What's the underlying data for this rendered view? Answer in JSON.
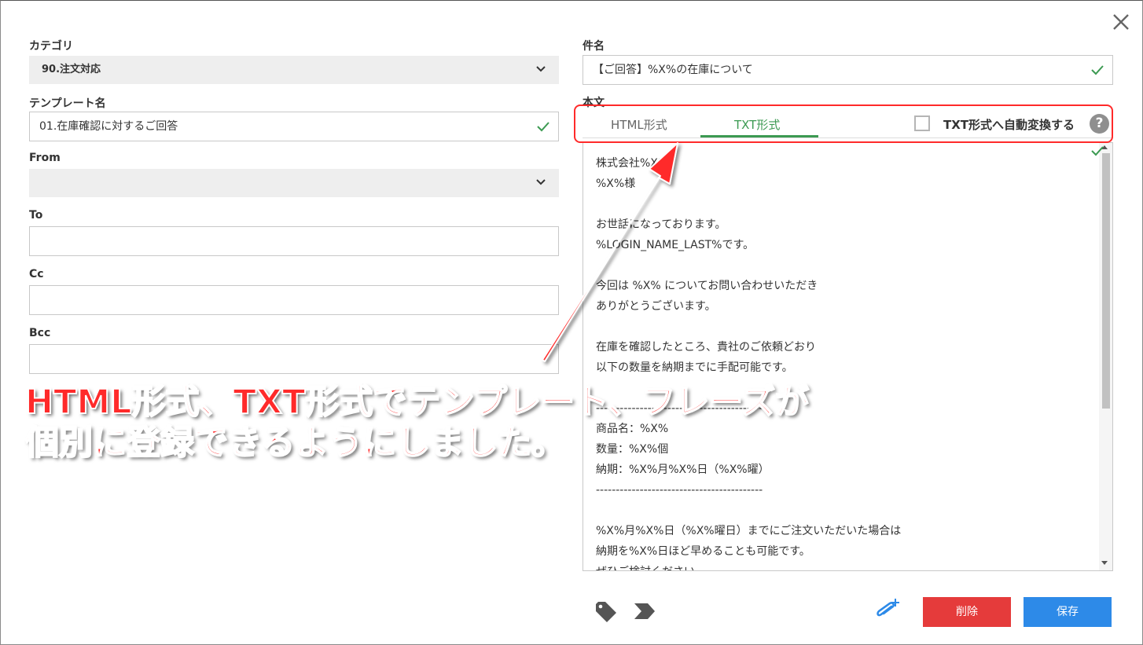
{
  "dialog": {
    "close_glyph": "✕"
  },
  "left": {
    "category": {
      "label": "カテゴリ",
      "value": "90.注文対応"
    },
    "template_name": {
      "label": "テンプレート名",
      "value": "01.在庫確認に対するご回答"
    },
    "from": {
      "label": "From",
      "value": ""
    },
    "to": {
      "label": "To",
      "value": ""
    },
    "cc": {
      "label": "Cc",
      "value": ""
    },
    "bcc": {
      "label": "Bcc",
      "value": ""
    }
  },
  "right": {
    "subject": {
      "label": "件名",
      "value": "【ご回答】%X%の在庫について"
    },
    "body": {
      "label": "本文",
      "tabs": [
        {
          "label": "HTML形式"
        },
        {
          "label": "TXT形式"
        }
      ],
      "active_tab": "TXT形式",
      "auto_convert_label": "TXT形式へ自動変換する",
      "help_glyph": "?",
      "text": "株式会社%X%\n%X%様\n\nお世話になっております。\n%LOGIN_NAME_LAST%です。\n\n今回は %X% についてお問い合わせいただき\nありがとうございます。\n\n在庫を確認したところ、貴社のご依頼どおり\n以下の数量を納期までに手配可能です。\n\n------------------------------------------\n商品名：%X%\n数量：%X%個\n納期：%X%月%X%日（%X%曜）\n------------------------------------------\n\n%X%月%X%日（%X%曜日）までにご注文いただいた場合は\n納期を%X%日ほど早めることも可能です。\nぜひご検討ください。"
    }
  },
  "footer": {
    "delete_label": "削除",
    "save_label": "保存"
  },
  "annotation": {
    "text": "HTML形式、TXT形式でテンプレート、フレーズが\n個別に登録できるようにしました。"
  },
  "colors": {
    "accent_green": "#3c9a52",
    "delete_red": "#e53b3b",
    "save_blue": "#2d8ae8",
    "annotation_red": "#ff2a2a"
  }
}
